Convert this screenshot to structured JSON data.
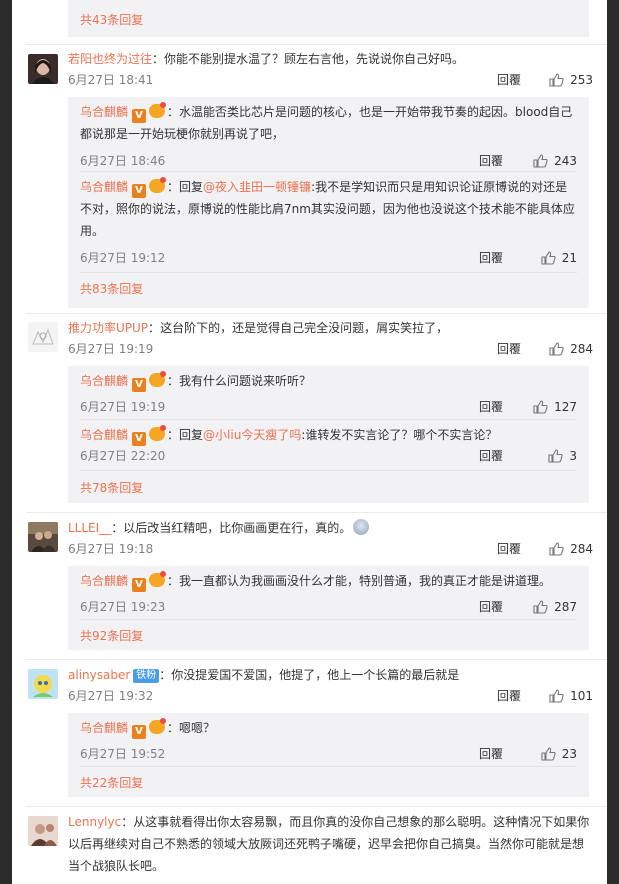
{
  "colors": {
    "accent": "#eb7350",
    "meta": "#808080",
    "subbg": "#f2f2f5"
  },
  "top": {
    "more_label": "共43条回复"
  },
  "comments": [
    {
      "user": "若阳也终为过往",
      "sep": "：",
      "text": "你能不能别提水温了？顾左右言他，先说说你自己好吗。",
      "time": "6月27日 18:41",
      "reply_label": "回覆",
      "likes": "253",
      "replies": [
        {
          "user": "乌合麒麟",
          "sep": "：",
          "text": "水温能否类比芯片是问题的核心，也是一开始带我节奏的起因。blood自己都说那是一开始玩梗你就别再说了吧，",
          "time": "6月27日 18:46",
          "reply_label": "回覆",
          "likes": "243"
        },
        {
          "user": "乌合麒麟",
          "sep": "：",
          "prefix": "回复",
          "mention": "@夜入韭田一顿锤镰",
          "text": ":我不是学知识而只是用知识论证原博说的对还是不对，照你的说法，原博说的性能比肩7nm其实没问题，因为他也没说这个技术能不能具体应用。",
          "time": "6月27日 19:12",
          "reply_label": "回覆",
          "likes": "21"
        }
      ],
      "more_label": "共83条回复"
    },
    {
      "user": "推力功率UPUP",
      "sep": "：",
      "text": "这台阶下的，还是觉得自己完全没问题，屑实笑拉了，",
      "time": "6月27日 19:19",
      "reply_label": "回覆",
      "likes": "284",
      "replies": [
        {
          "user": "乌合麒麟",
          "sep": "：",
          "text": "我有什么问题说来听听？",
          "time": "6月27日 19:19",
          "reply_label": "回覆",
          "likes": "127"
        },
        {
          "user": "乌合麒麟",
          "sep": "：",
          "prefix": "回复",
          "mention": "@小liu今天瘦了吗",
          "text": ":谁转发不实言论了？哪个不实言论？",
          "time": "6月27日 22:20",
          "reply_label": "回覆",
          "likes": "3"
        }
      ],
      "more_label": "共78条回复"
    },
    {
      "user": "LLLEI__",
      "sep": "：",
      "text": "以后改当红精吧，比你画画更在行，真的。",
      "time": "6月27日 19:18",
      "reply_label": "回覆",
      "likes": "284",
      "replies": [
        {
          "user": "乌合麒麟",
          "sep": "：",
          "text": "我一直都认为我画画没什么才能，特别普通，我的真正才能是讲道理。",
          "time": "6月27日 19:23",
          "reply_label": "回覆",
          "likes": "287"
        }
      ],
      "more_label": "共92条回复"
    },
    {
      "user": "alinysaber",
      "badge": "铁粉",
      "sep": "：",
      "text": "你没提爱国不爱国，他提了，他上一个长篇的最后就是",
      "time": "6月27日 19:32",
      "reply_label": "回覆",
      "likes": "101",
      "replies": [
        {
          "user": "乌合麒麟",
          "sep": "：",
          "text": "嗯嗯？",
          "time": "6月27日 19:52",
          "reply_label": "回覆",
          "likes": "23"
        }
      ],
      "more_label": "共22条回复"
    },
    {
      "user": "Lennylyc",
      "sep": "：",
      "text": "从这事就看得出你太容易飘，而且你真的没你自己想象的那么聪明。这种情况下如果你以后再继续对自己不熟悉的领域大放厥词还死鸭子嘴硬，迟早会把你自己搞臭。当然你可能就是想当个战狼队长吧。"
    }
  ]
}
